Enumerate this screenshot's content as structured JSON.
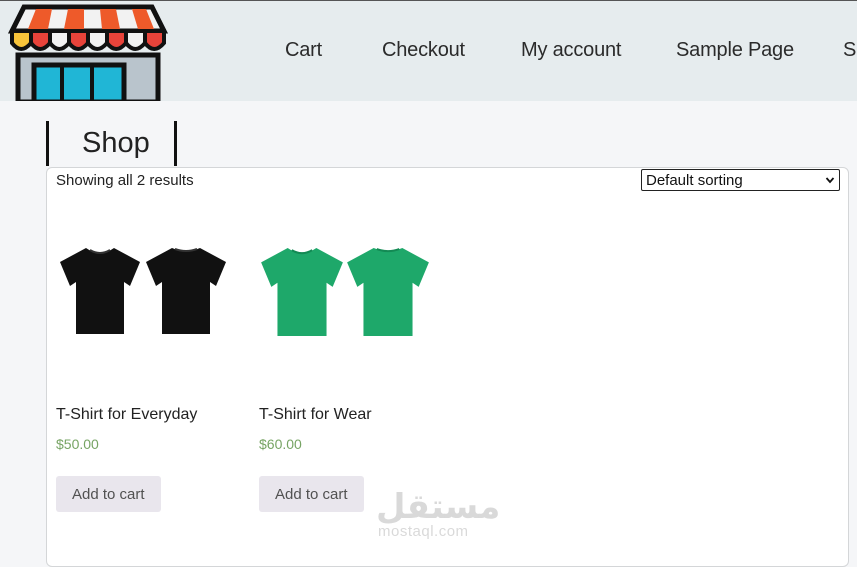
{
  "nav": {
    "items": [
      {
        "label": "Cart"
      },
      {
        "label": "Checkout"
      },
      {
        "label": "My account"
      },
      {
        "label": "Sample Page"
      },
      {
        "label": "Sh"
      }
    ]
  },
  "page": {
    "title": "Shop"
  },
  "shop": {
    "result_count": "Showing all 2 results",
    "sorting": {
      "selected": "Default sorting"
    }
  },
  "products": [
    {
      "name": "T-Shirt for Everyday",
      "price": "$50.00",
      "button": "Add to cart",
      "shirt_color": "#111111"
    },
    {
      "name": "T-Shirt for Wear",
      "price": "$60.00",
      "button": "Add to cart",
      "shirt_color": "#1ea86a"
    }
  ],
  "watermark": {
    "arabic": "مستقل",
    "latin": "mostaql.com"
  },
  "colors": {
    "header_bg": "#e6ecee",
    "price": "#77a464",
    "button_bg": "#e9e6ed"
  }
}
